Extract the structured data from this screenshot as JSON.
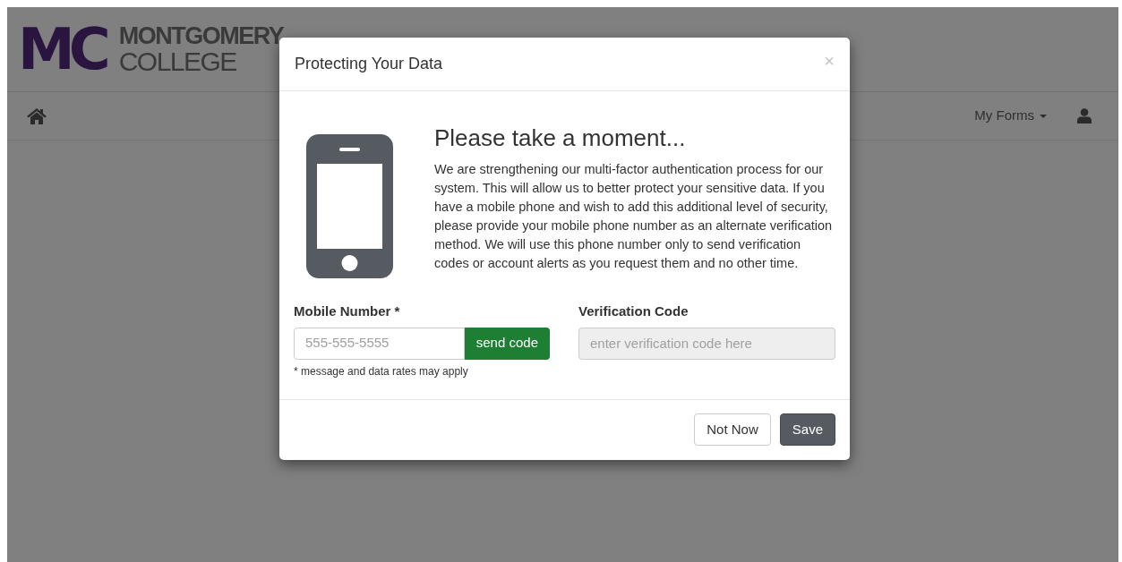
{
  "logo": {
    "mark": "MC",
    "line_1": "MONTGOMERY",
    "line_2": "COLLEGE"
  },
  "navbar": {
    "menu": "My Forms"
  },
  "dialog": {
    "title": "Protecting Your Data",
    "close": "×",
    "heading": "Please take a moment...",
    "message": "We are strengthening our multi-factor authentication process for our system. This will allow us to better protect your sensitive data. If you have a mobile phone and wish to add this additional level of security, please provide your mobile phone number as an alternate verification method. We will use this phone number only to send verification codes or account alerts as you request them and no other time.",
    "mobile": {
      "label": "Mobile Number *",
      "placeholder": "555-555-5555",
      "button": "send code",
      "note": "* message and data rates may apply"
    },
    "verification": {
      "label": "Verification Code",
      "placeholder": "enter verification code here",
      "disabled": true
    },
    "buttons": [
      {
        "label": "Not Now",
        "kind": "default"
      },
      {
        "label": "Save",
        "kind": "primary"
      }
    ]
  }
}
